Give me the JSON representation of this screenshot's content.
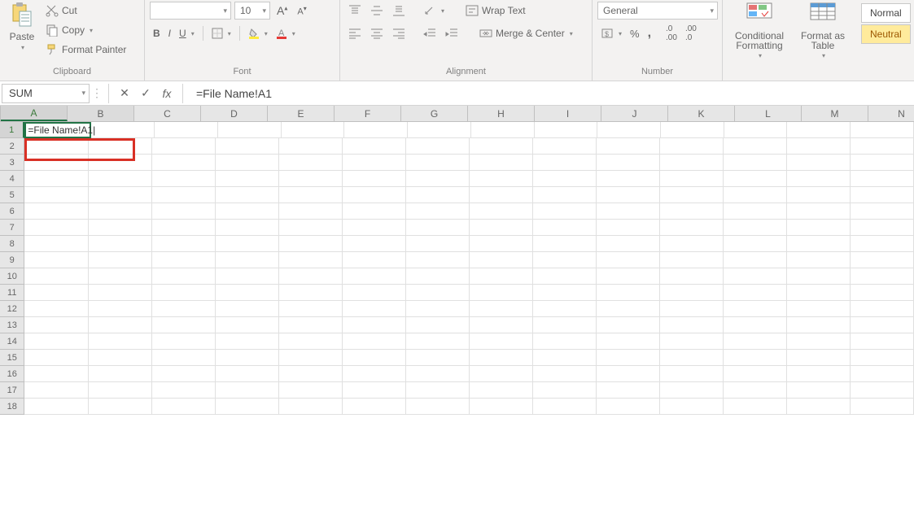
{
  "ribbon": {
    "clipboard": {
      "paste": "Paste",
      "cut": "Cut",
      "copy": "Copy",
      "format_painter": "Format Painter",
      "label": "Clipboard"
    },
    "font": {
      "size": "10",
      "label": "Font"
    },
    "alignment": {
      "wrap": "Wrap Text",
      "merge": "Merge & Center",
      "label": "Alignment"
    },
    "number": {
      "format": "General",
      "label": "Number"
    },
    "styles": {
      "cond": "Conditional Formatting",
      "table": "Format as Table",
      "normal": "Normal",
      "neutral": "Neutral"
    }
  },
  "formula_bar": {
    "name_box": "SUM",
    "fx": "fx",
    "formula": "=File Name!A1"
  },
  "grid": {
    "columns": [
      "A",
      "B",
      "C",
      "D",
      "E",
      "F",
      "G",
      "H",
      "I",
      "J",
      "K",
      "L",
      "M",
      "N"
    ],
    "row_count": 18,
    "active_cell": {
      "row": 1,
      "col": "A",
      "value": "=File Name!A1"
    }
  }
}
